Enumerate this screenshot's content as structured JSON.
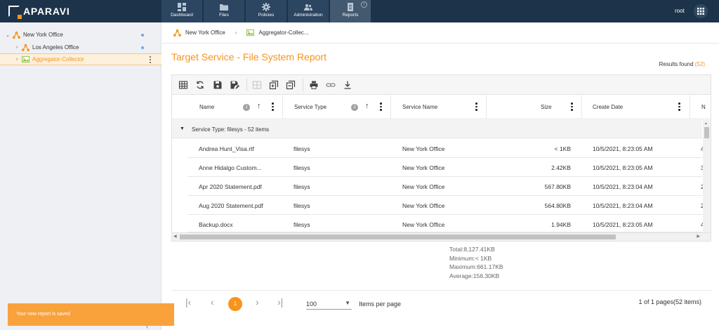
{
  "app": {
    "logo_text": "APARAVI"
  },
  "nav": {
    "tabs": [
      {
        "label": "Dashboard",
        "icon": "dashboard-icon"
      },
      {
        "label": "Files",
        "icon": "folder-icon"
      },
      {
        "label": "Policies",
        "icon": "gear-icon"
      },
      {
        "label": "Administration",
        "icon": "users-icon"
      },
      {
        "label": "Reports",
        "icon": "report-icon",
        "active": true
      }
    ],
    "info_glyph": "i",
    "user": "root"
  },
  "sidebar": {
    "items": [
      {
        "label": "New York Office",
        "caret": "⌄",
        "icon": "network-icon"
      },
      {
        "label": "Los Angeles Office",
        "caret": "›",
        "icon": "network-icon"
      },
      {
        "label": "Aggregator-Collector",
        "caret": "›",
        "icon": "collector-icon",
        "selected": true
      }
    ],
    "collapse_glyph": "‹"
  },
  "breadcrumb": {
    "first": "New York Office",
    "separator": "›",
    "second": "Aggregator-Collec..."
  },
  "page": {
    "title": "Target Service - File System Report",
    "results_label": "Results found ",
    "results_count": "(52)"
  },
  "grid": {
    "columns": [
      {
        "label": "Name",
        "badge": "1",
        "sort": "↑"
      },
      {
        "label": "Service Type",
        "badge": "2",
        "sort": "↑"
      },
      {
        "label": "Service Name"
      },
      {
        "label": "Size"
      },
      {
        "label": "Create Date"
      },
      {
        "label": "N"
      }
    ],
    "group": {
      "toggle": "▼",
      "label": "Service Type: filesys - 52 items"
    },
    "rows": [
      {
        "name": "Andrea Hunt_Visa.rtf",
        "type": "filesys",
        "service": "New York Office",
        "size": "< 1KB",
        "date": "10/5/2021, 8:23:05 AM",
        "extra": "4"
      },
      {
        "name": "Anne Hidalgo Custom...",
        "type": "filesys",
        "service": "New York Office",
        "size": "2.42KB",
        "date": "10/5/2021, 8:23:05 AM",
        "extra": "3"
      },
      {
        "name": "Apr 2020 Statement.pdf",
        "type": "filesys",
        "service": "New York Office",
        "size": "567.80KB",
        "date": "10/5/2021, 8:23:04 AM",
        "extra": "2"
      },
      {
        "name": "Aug 2020 Statement.pdf",
        "type": "filesys",
        "service": "New York Office",
        "size": "564.80KB",
        "date": "10/5/2021, 8:23:04 AM",
        "extra": "2"
      },
      {
        "name": "Backup.docx",
        "type": "filesys",
        "service": "New York Office",
        "size": "1.94KB",
        "date": "10/5/2021, 8:23:05 AM",
        "extra": "4"
      }
    ]
  },
  "summary": {
    "total": "Total:8,127.41KB",
    "minimum": "Minimum:< 1KB",
    "maximum": "Maximum:661.17KB",
    "average": "Average:156.30KB"
  },
  "pager": {
    "first": "|‹",
    "prev": "‹",
    "current": "1",
    "next": "›",
    "last": "›|",
    "page_size": "100",
    "dropdown": "▼",
    "items_per_page": "Items per page",
    "info": "1 of 1 pages(52 items)"
  },
  "toast": {
    "message": "Your new report is saved"
  },
  "colors": {
    "accent": "#f7941d",
    "topbar": "#1d3349"
  }
}
